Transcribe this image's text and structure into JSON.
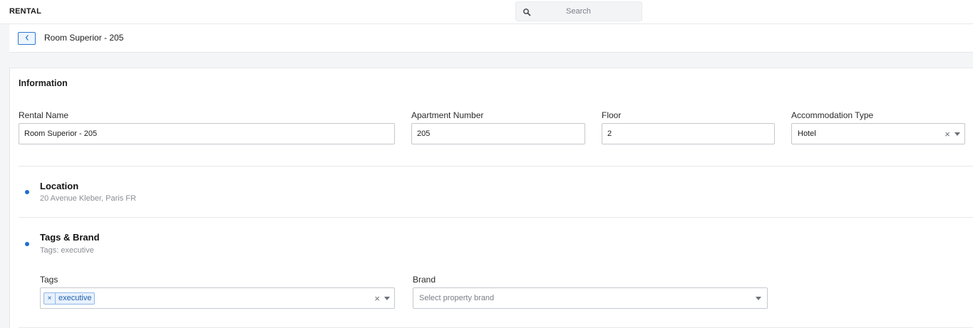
{
  "app": {
    "title": "RENTAL"
  },
  "search": {
    "placeholder": "Search"
  },
  "breadcrumb": {
    "current": "Room Superior - 205"
  },
  "information": {
    "title": "Information",
    "rental_name": {
      "label": "Rental Name",
      "value": "Room Superior - 205"
    },
    "apartment_number": {
      "label": "Apartment Number",
      "value": "205"
    },
    "floor": {
      "label": "Floor",
      "value": "2"
    },
    "accommodation_type": {
      "label": "Accommodation Type",
      "value": "Hotel"
    }
  },
  "location": {
    "title": "Location",
    "summary": "20 Avenue Kleber, Paris FR"
  },
  "tags_brand": {
    "title": "Tags & Brand",
    "summary": "Tags: executive",
    "tags": {
      "label": "Tags",
      "items": [
        "executive"
      ]
    },
    "brand": {
      "label": "Brand",
      "placeholder": "Select property brand"
    }
  },
  "colors": {
    "accent": "#1f6fd1",
    "chip_bg": "#e8f1fc",
    "border": "#c4c8cd"
  },
  "icons": {
    "search": "search-icon",
    "back": "chevron-left-icon",
    "clear": "close-icon",
    "dropdown": "caret-down-icon"
  }
}
